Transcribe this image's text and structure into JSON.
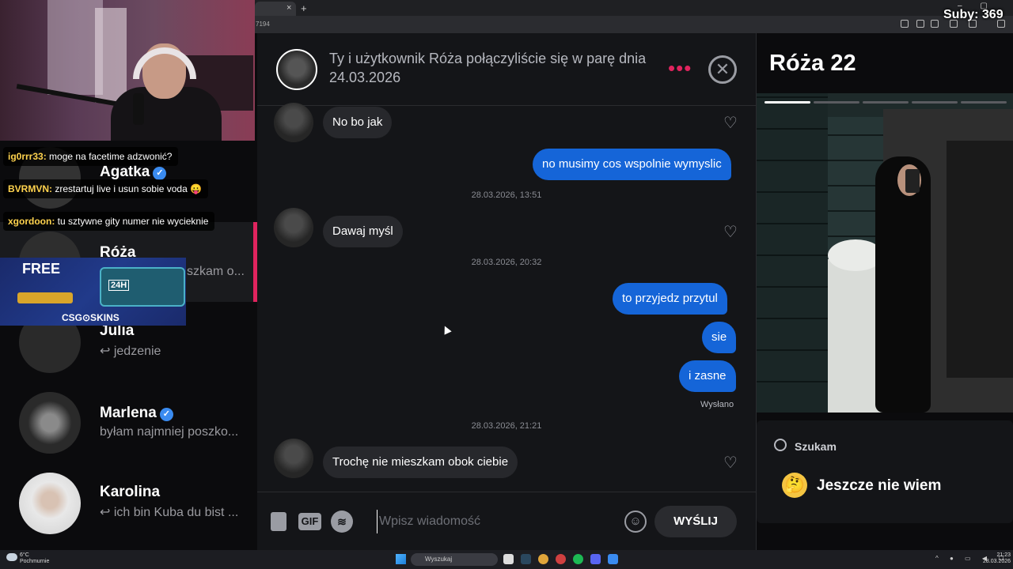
{
  "browser": {
    "address_fragment": "7194",
    "tab_close": "×",
    "new_tab": "+"
  },
  "overlay": {
    "subs_counter": "Suby: 369",
    "stream_chat": [
      {
        "user": "ig0rrr33:",
        "message": "moge na facetime adzwonić?"
      },
      {
        "user": "BVRMVN:",
        "message": "zrestartuj live i usun sobie voda 😛"
      },
      {
        "user": "xgordoon:",
        "message": "tu sztywne gity numer nie wycieknie"
      }
    ],
    "promo": {
      "headline": "FREE",
      "badge": "24H",
      "brand": "CSG⊙SKINS"
    }
  },
  "conversations": [
    {
      "name": "Agatka",
      "verified": true,
      "preview": ""
    },
    {
      "name": "Róża",
      "verified": false,
      "preview": "szkam o..."
    },
    {
      "name": "Julia",
      "verified": false,
      "preview": "↩ jedzenie"
    },
    {
      "name": "Marlena",
      "verified": true,
      "preview": "byłam najmniej poszko..."
    },
    {
      "name": "Karolina",
      "verified": false,
      "preview": "↩ ich bin Kuba du bist ..."
    }
  ],
  "chat": {
    "match_text": "Ty i użytkownik Róża połączyliście się w parę dnia 24.03.2026",
    "more_icon": "•••",
    "close_icon": "✕",
    "messages": [
      {
        "dir": "in",
        "text": "No bo jak"
      },
      {
        "dir": "out",
        "text": "no musimy cos wspolnie wymyslic"
      },
      {
        "dir": "ts",
        "text": "28.03.2026, 13:51"
      },
      {
        "dir": "in",
        "text": "Dawaj myśl"
      },
      {
        "dir": "ts",
        "text": "28.03.2026, 20:32"
      },
      {
        "dir": "out",
        "text": "to przyjedz przytul"
      },
      {
        "dir": "out",
        "text": "sie"
      },
      {
        "dir": "out",
        "text": "i zasne"
      },
      {
        "dir": "ts",
        "text": "28.03.2026, 21:21"
      },
      {
        "dir": "in",
        "text": "Trochę nie mieszkam obok ciebie"
      }
    ],
    "sent_status": "Wysłano",
    "heart_icon": "♡",
    "composer": {
      "gif_label": "GIF",
      "placeholder": "Wpisz wiadomość",
      "emoji_icon": "☺",
      "send_label": "WYŚLIJ"
    }
  },
  "profile": {
    "name_age": "Róża 22",
    "looking_for_label": "Szukam",
    "looking_for_value": "Jeszcze nie wiem",
    "looking_emoji": "🤔",
    "photo_count": 5,
    "photo_index": 1
  },
  "taskbar": {
    "weather_temp": "6°C",
    "weather_desc": "Pochmurnie",
    "search_placeholder": "Wyszukaj",
    "time": "21:23",
    "date": "28.03.2026"
  },
  "colors": {
    "accent_pink": "#e0245e",
    "outgoing_bubble": "#1565d8",
    "verified_blue": "#3a8bf0"
  }
}
